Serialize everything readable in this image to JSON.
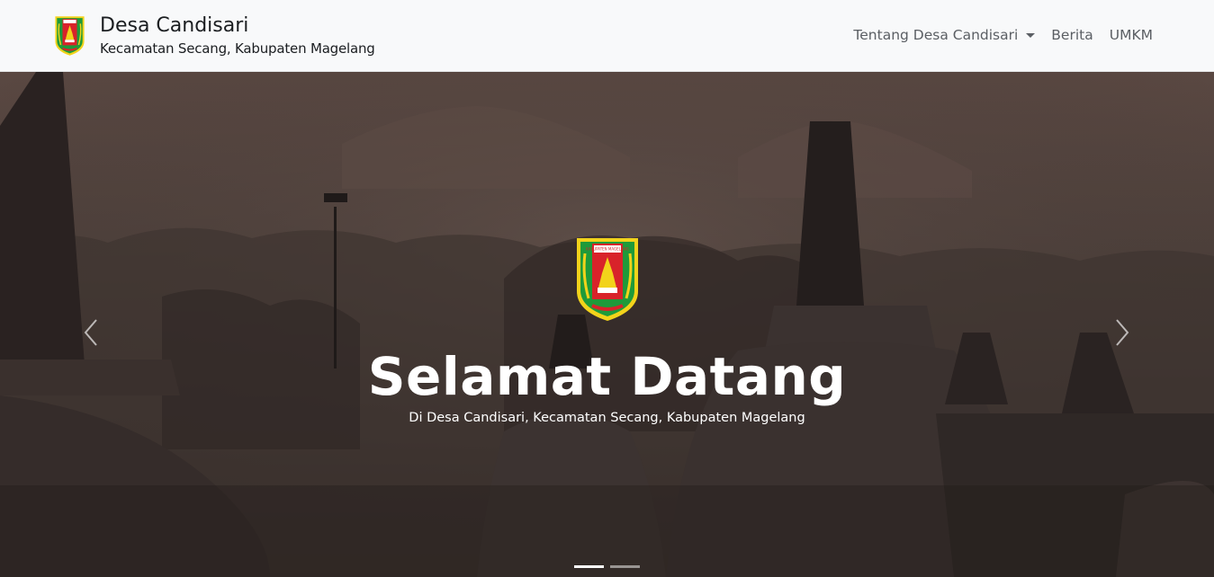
{
  "navbar": {
    "brand_title": "Desa Candisari",
    "brand_subtitle": "Kecamatan Secang, Kabupaten Magelang",
    "links": [
      {
        "label": "Tentang Desa Candisari",
        "dropdown": true
      },
      {
        "label": "Berita"
      },
      {
        "label": "UMKM"
      }
    ]
  },
  "hero": {
    "title": "Selamat Datang",
    "subtitle": "Di Desa Candisari, Kecamatan Secang, Kabupaten Magelang",
    "emblem_text": "KABUPATEN MAGELANG",
    "slide_count": 2,
    "active_slide": 1
  },
  "icons": {
    "prev": "chevron-left-icon",
    "next": "chevron-right-icon",
    "dropdown": "caret-down-icon",
    "logo": "magelang-emblem-icon"
  },
  "colors": {
    "navbar_bg": "#f8f9fa",
    "nav_text": "#5b5f64",
    "emblem_green": "#1f9a3a",
    "emblem_red": "#d8232a",
    "emblem_yellow": "#f2d31b"
  }
}
